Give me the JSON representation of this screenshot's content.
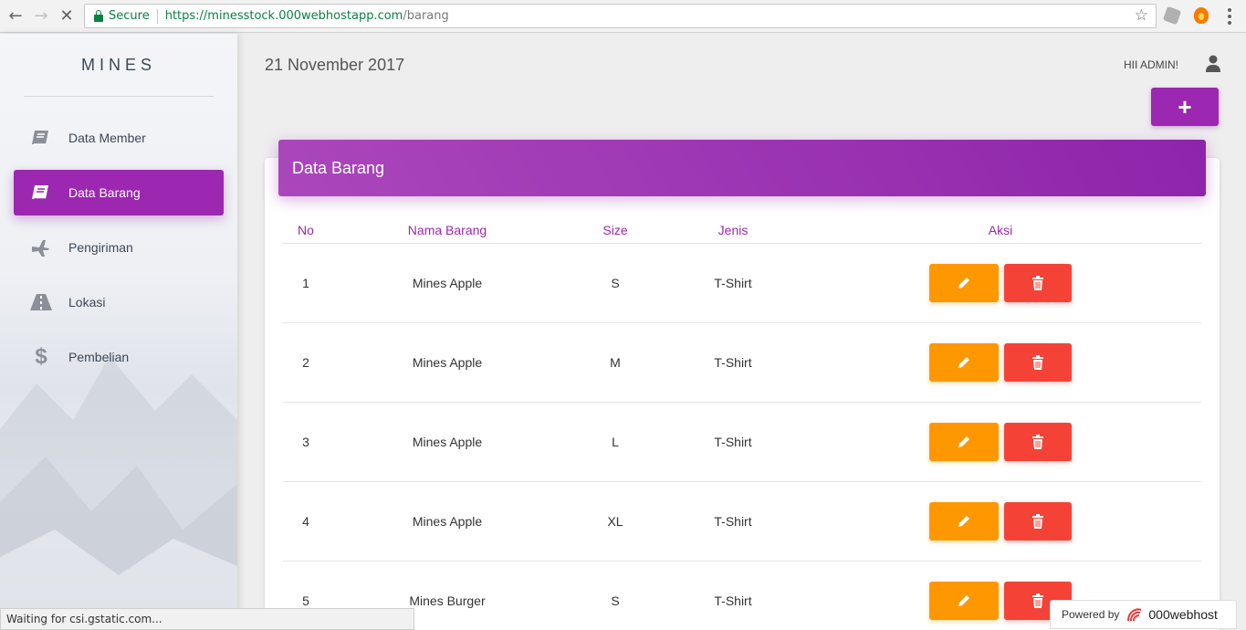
{
  "browser": {
    "secure_label": "Secure",
    "url_host": "https://minesstock.000webhostapp.com",
    "url_path": "/barang",
    "status_text": "Waiting for csi.gstatic.com..."
  },
  "sidebar": {
    "brand": "MINES",
    "items": [
      {
        "label": "Data Member",
        "icon": "book-icon",
        "active": false
      },
      {
        "label": "Data Barang",
        "icon": "book-icon",
        "active": true
      },
      {
        "label": "Pengiriman",
        "icon": "airplane-icon",
        "active": false
      },
      {
        "label": "Lokasi",
        "icon": "road-icon",
        "active": false
      },
      {
        "label": "Pembelian",
        "icon": "dollar-icon",
        "active": false
      }
    ]
  },
  "header": {
    "date": "21 November 2017",
    "greeting": "HII ADMIN!",
    "add_label": "+"
  },
  "table": {
    "title": "Data Barang",
    "columns": [
      "No",
      "Nama Barang",
      "Size",
      "Jenis",
      "Aksi"
    ],
    "rows": [
      {
        "no": "1",
        "nama": "Mines Apple",
        "size": "S",
        "jenis": "T-Shirt"
      },
      {
        "no": "2",
        "nama": "Mines Apple",
        "size": "M",
        "jenis": "T-Shirt"
      },
      {
        "no": "3",
        "nama": "Mines Apple",
        "size": "L",
        "jenis": "T-Shirt"
      },
      {
        "no": "4",
        "nama": "Mines Apple",
        "size": "XL",
        "jenis": "T-Shirt"
      },
      {
        "no": "5",
        "nama": "Mines Burger",
        "size": "S",
        "jenis": "T-Shirt"
      }
    ]
  },
  "badge": {
    "powered_by": "Powered by",
    "host_name": "000webhost"
  },
  "colors": {
    "primary": "#9c27b0",
    "edit": "#ff9800",
    "delete": "#f44336"
  }
}
